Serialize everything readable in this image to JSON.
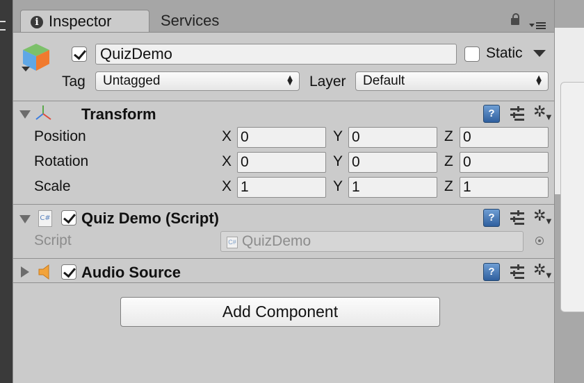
{
  "tabs": [
    {
      "label": "Inspector",
      "active": true
    },
    {
      "label": "Services",
      "active": false
    }
  ],
  "gameobject": {
    "active": true,
    "name": "QuizDemo",
    "static_label": "Static",
    "static_checked": false,
    "tag_label": "Tag",
    "tag_value": "Untagged",
    "layer_label": "Layer",
    "layer_value": "Default"
  },
  "transform": {
    "title": "Transform",
    "axis_labels": {
      "x": "X",
      "y": "Y",
      "z": "Z"
    },
    "rows": [
      {
        "label": "Position",
        "x": "0",
        "y": "0",
        "z": "0"
      },
      {
        "label": "Rotation",
        "x": "0",
        "y": "0",
        "z": "0"
      },
      {
        "label": "Scale",
        "x": "1",
        "y": "1",
        "z": "1"
      }
    ]
  },
  "quiz_script": {
    "title": "Quiz Demo (Script)",
    "enabled": true,
    "field_label": "Script",
    "field_value": "QuizDemo",
    "file_badge": "C#"
  },
  "audio_source": {
    "title": "Audio Source",
    "enabled": true,
    "expanded": false
  },
  "add_component_label": "Add Component",
  "icons": {
    "help": "?",
    "gear": "✲",
    "csharp": "C#"
  },
  "colors": {
    "panel_bg": "#cbcbcb",
    "tab_bar_bg": "#a6a6a6",
    "help_icon_blue": "#3f6fb0",
    "speaker_orange": "#f2a33a"
  }
}
